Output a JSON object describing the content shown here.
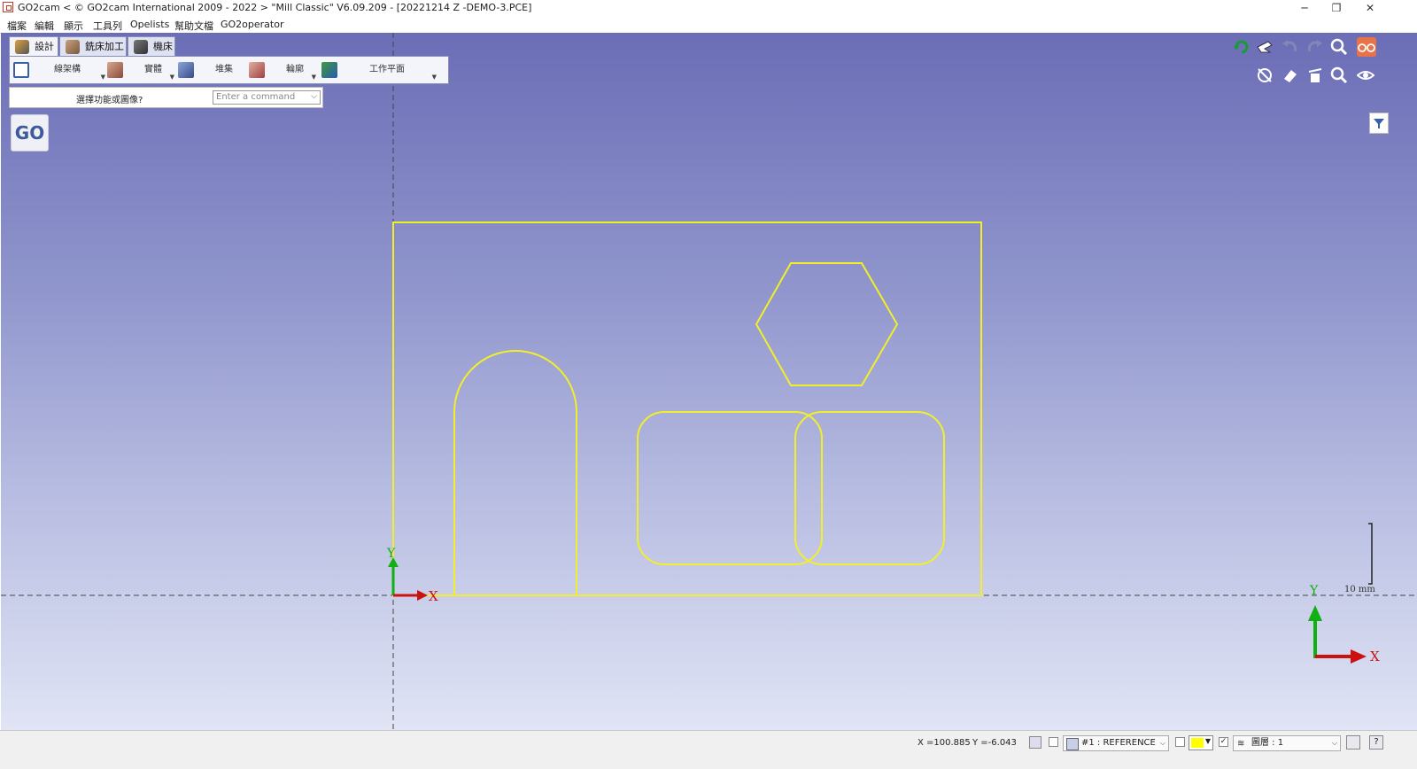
{
  "window": {
    "title": "GO2cam < © GO2cam International 2009 - 2022 >    \"Mill Classic\"  V6.09.209 - [20221214 Z -DEMO-3.PCE]",
    "minimize": "─",
    "restore": "❐",
    "close": "✕"
  },
  "menu": [
    "檔案",
    "編輯",
    "顯示",
    "工具列",
    "Opelists",
    "幫助文檔",
    "GO2operator"
  ],
  "ribbon": {
    "tabs": [
      "設計",
      "銑床加工",
      "機床"
    ],
    "buttons": [
      "線架構",
      "實體",
      "堆集",
      "輪廓",
      "工作平面"
    ]
  },
  "command": {
    "prompt": "選擇功能或圖像?",
    "placeholder": "Enter a command"
  },
  "go_button": "GO",
  "axes": {
    "origin_x_label": "X",
    "origin_y_label": "Y",
    "corner_x_label": "X",
    "corner_y_label": "Y"
  },
  "scale": {
    "label": "10 mm"
  },
  "status": {
    "x_coord": "X =100.885",
    "y_coord": "Y =-6.043",
    "layer_ref": "#1 : REFERENCE",
    "layer_num": "圖層 : 1",
    "color_swatch": "#ffff00"
  },
  "colors": {
    "geometry": "#f2ef2a",
    "x_axis": "#cc1111",
    "y_axis": "#10b010"
  }
}
